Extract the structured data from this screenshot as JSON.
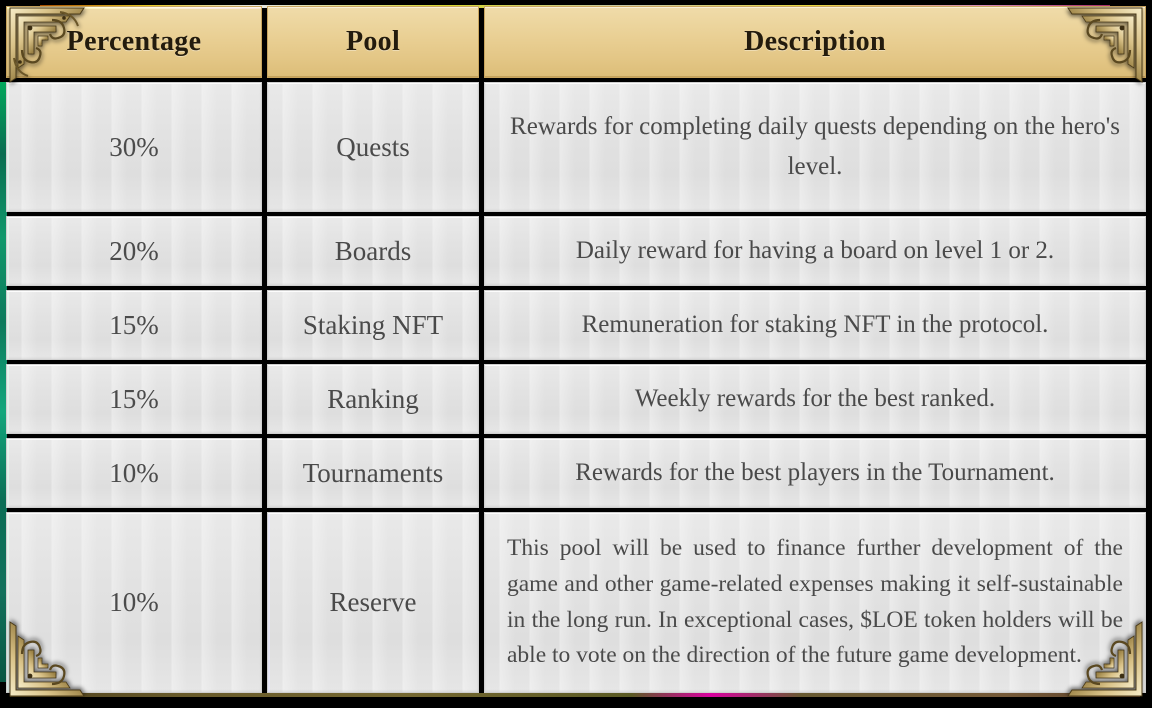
{
  "table": {
    "columns": [
      {
        "key": "percentage",
        "label": "Percentage"
      },
      {
        "key": "pool",
        "label": "Pool"
      },
      {
        "key": "description",
        "label": "Description"
      }
    ],
    "rows": [
      {
        "percentage": "30%",
        "pool": "Quests",
        "description": "Rewards for completing daily quests depending on the hero's level."
      },
      {
        "percentage": "20%",
        "pool": "Boards",
        "description": "Daily reward for having a board on level 1 or 2."
      },
      {
        "percentage": "15%",
        "pool": "Staking NFT",
        "description": "Remuneration for staking NFT in the protocol."
      },
      {
        "percentage": "15%",
        "pool": "Ranking",
        "description": "Weekly rewards for the best ranked."
      },
      {
        "percentage": "10%",
        "pool": "Tournaments",
        "description": "Rewards for the best players in the Tournament."
      },
      {
        "percentage": "10%",
        "pool": "Reserve",
        "description": "This pool will be used to finance further development of the game and other game-related expenses making it self-sustainable in the long run. In exceptional cases, $LOE token holders will be able to vote on the direction of the future game development."
      }
    ]
  },
  "ornaments": {
    "top_left": "celtic-corner-ornament",
    "top_right": "celtic-corner-ornament",
    "bottom_left": "celtic-corner-ornament",
    "bottom_right": "celtic-corner-ornament"
  },
  "colors": {
    "background": "#000000",
    "header_fill": "#e9cf93",
    "header_fill_light": "#f0dcaa",
    "header_border": "#c9a55e",
    "header_text": "#231b0d",
    "cell_fill": "#e3e3e3",
    "cell_border": "#cfcfcf",
    "cell_text": "#4a4a4a",
    "ornament_gold": "#c9b municipality"
  }
}
